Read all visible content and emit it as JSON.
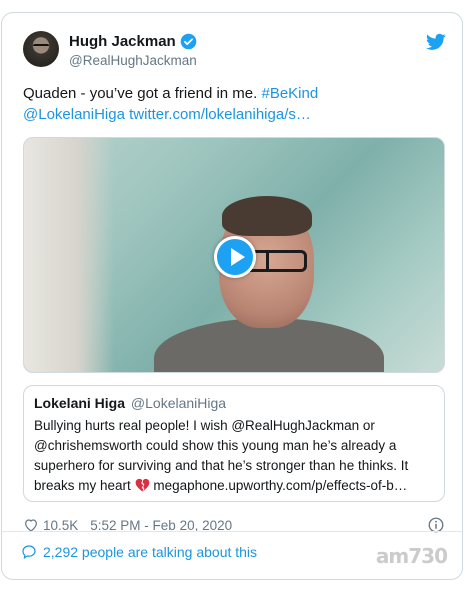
{
  "colors": {
    "link": "#1b95e0",
    "verified": "#1da1f2",
    "muted": "#657786"
  },
  "author": {
    "name": "Hugh Jackman",
    "handle": "@RealHughJackman"
  },
  "tweet": {
    "text": "Quaden - you’ve got a friend in me.",
    "hashtag": "#BeKind",
    "mention": "@LokelaniHiga",
    "link": "twitter.com/lokelanihiga/s…"
  },
  "quoted": {
    "name": "Lokelani Higa",
    "handle": "@LokelaniHiga",
    "text": "Bullying hurts real people! I wish @RealHughJackman or @chrishemsworth could show this young man he’s already a superhero for surviving and that he’s stronger than he thinks. It breaks my heart",
    "link": "megaphone.upworthy.com/p/effects-of-b…"
  },
  "stats": {
    "likes": "10.5K",
    "timestamp": "5:52 PM - Feb 20, 2020"
  },
  "footer": {
    "talking": "2,292 people are talking about this"
  },
  "icons": {
    "verified": "verified-badge-icon",
    "bird": "twitter-bird-icon",
    "play": "play-icon",
    "heart": "heart-icon",
    "info": "info-icon",
    "comment": "comment-bubble-icon",
    "broken_heart": "broken-heart-emoji"
  },
  "watermark": "am730"
}
